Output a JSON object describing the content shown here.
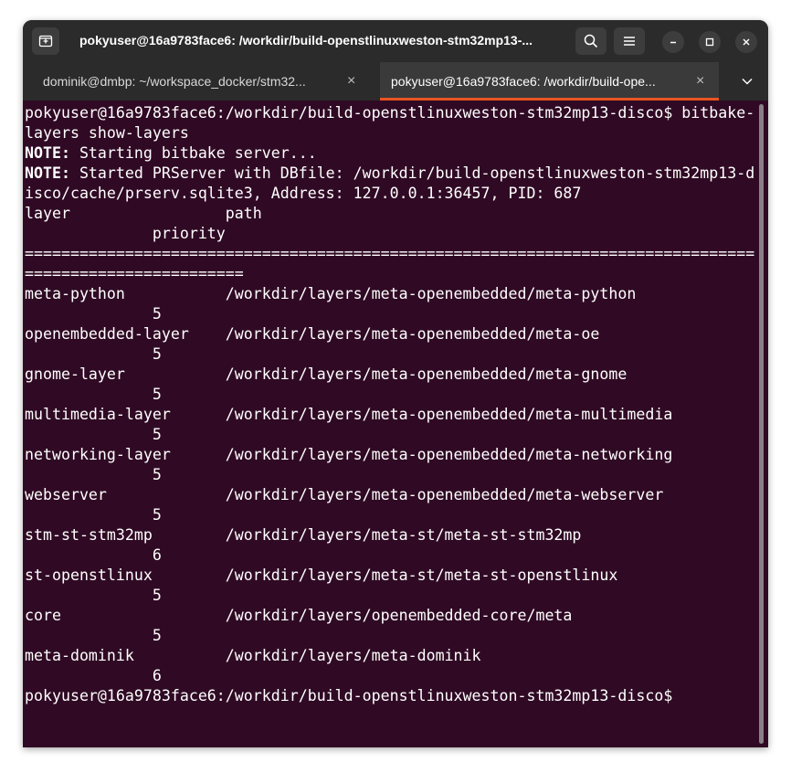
{
  "window": {
    "title": "pokyuser@16a9783face6: /workdir/build-openstlinuxweston-stm32mp13-...",
    "icons": {
      "new_tab": "new-tab-icon",
      "search": "search-icon",
      "menu": "hamburger-menu-icon",
      "minimize": "minimize-icon",
      "maximize": "maximize-icon",
      "close": "close-icon"
    }
  },
  "tabs": [
    {
      "label": "dominik@dmbp: ~/workspace_docker/stm32...",
      "close": "×",
      "active": false
    },
    {
      "label": "pokyuser@16a9783face6: /workdir/build-ope...",
      "close": "×",
      "active": true
    }
  ],
  "colors": {
    "terminal_bg": "#300a24",
    "titlebar_bg": "#2b2b2b",
    "active_tab_accent": "#e95420"
  },
  "terminal": {
    "lines": [
      {
        "text": "pokyuser@16a9783face6:/workdir/build-openstlinuxweston-stm32mp13-disco$ bitbake-"
      },
      {
        "text": "layers show-layers"
      },
      {
        "bold": "NOTE:",
        "text": " Starting bitbake server..."
      },
      {
        "bold": "NOTE:",
        "text": " Started PRServer with DBfile: /workdir/build-openstlinuxweston-stm32mp13-d"
      },
      {
        "text": "isco/cache/prserv.sqlite3, Address: 127.0.0.1:36457, PID: 687"
      },
      {
        "text": "layer                 path"
      },
      {
        "text": "              priority"
      },
      {
        "text": "================================================================================"
      },
      {
        "text": "========================"
      },
      {
        "text": "meta-python           /workdir/layers/meta-openembedded/meta-python"
      },
      {
        "text": "              5"
      },
      {
        "text": "openembedded-layer    /workdir/layers/meta-openembedded/meta-oe"
      },
      {
        "text": "              5"
      },
      {
        "text": "gnome-layer           /workdir/layers/meta-openembedded/meta-gnome"
      },
      {
        "text": "              5"
      },
      {
        "text": "multimedia-layer      /workdir/layers/meta-openembedded/meta-multimedia"
      },
      {
        "text": "              5"
      },
      {
        "text": "networking-layer      /workdir/layers/meta-openembedded/meta-networking"
      },
      {
        "text": "              5"
      },
      {
        "text": "webserver             /workdir/layers/meta-openembedded/meta-webserver"
      },
      {
        "text": "              5"
      },
      {
        "text": "stm-st-stm32mp        /workdir/layers/meta-st/meta-st-stm32mp"
      },
      {
        "text": "              6"
      },
      {
        "text": "st-openstlinux        /workdir/layers/meta-st/meta-st-openstlinux"
      },
      {
        "text": "              5"
      },
      {
        "text": "core                  /workdir/layers/openembedded-core/meta"
      },
      {
        "text": "              5"
      },
      {
        "text": "meta-dominik          /workdir/layers/meta-dominik"
      },
      {
        "text": "              6"
      },
      {
        "text": "pokyuser@16a9783face6:/workdir/build-openstlinuxweston-stm32mp13-disco$"
      }
    ]
  }
}
